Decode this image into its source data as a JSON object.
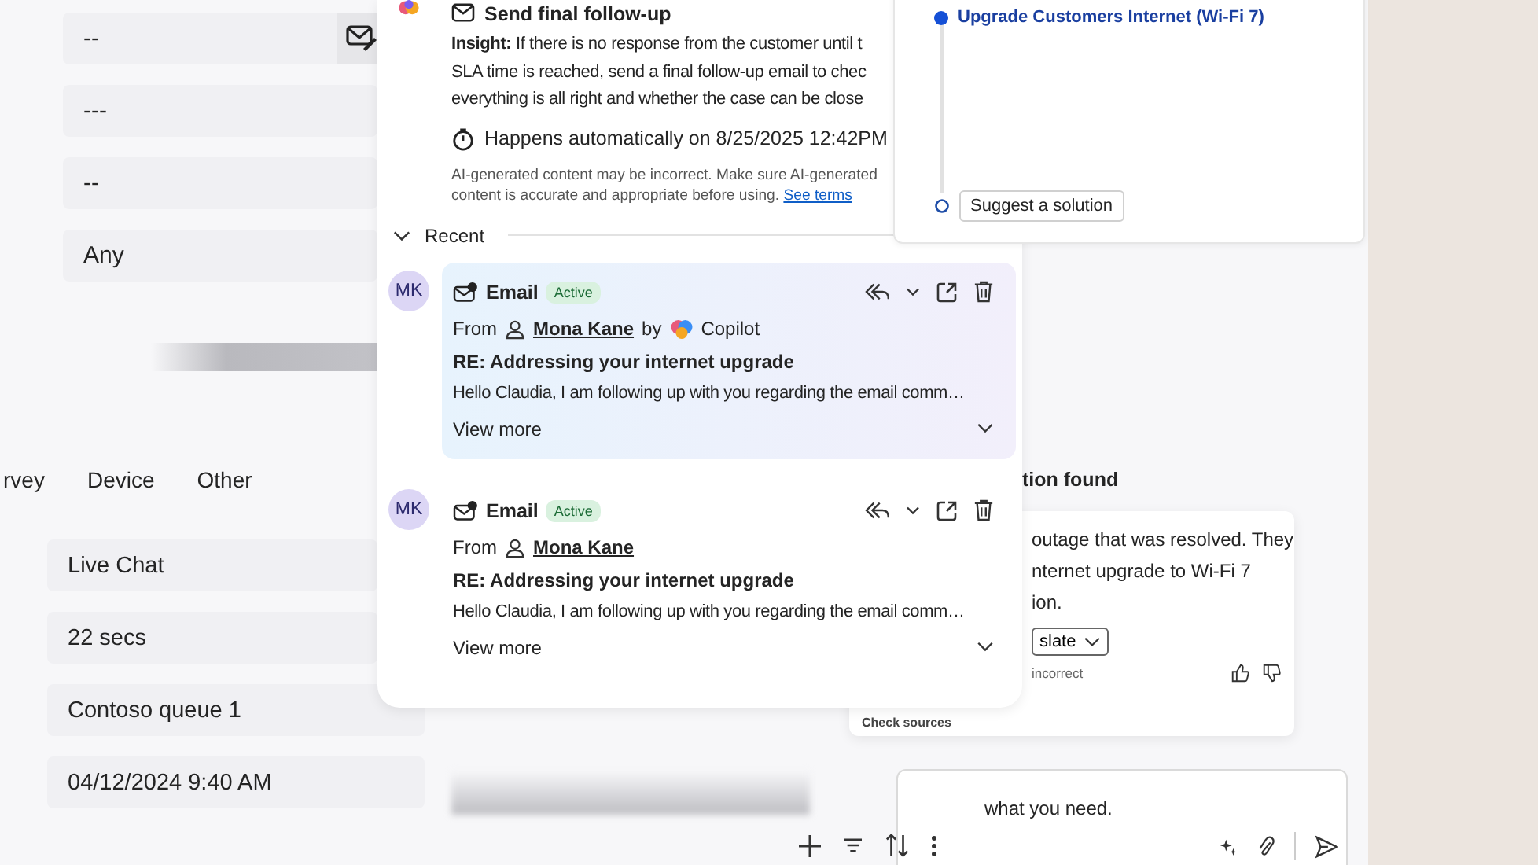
{
  "form_fields": [
    {
      "value": "--",
      "has_icon": true
    },
    {
      "value": "---",
      "has_icon": false
    },
    {
      "value": "--",
      "has_icon": false
    },
    {
      "value": "Any",
      "has_icon": false
    }
  ],
  "tabs": [
    {
      "label": "rvey"
    },
    {
      "label": "Device"
    },
    {
      "label": "Other"
    }
  ],
  "detail_fields": [
    {
      "value": "Live Chat"
    },
    {
      "value": "22 secs"
    },
    {
      "value": "Contoso queue 1"
    },
    {
      "value": "04/12/2024 9:40 AM"
    }
  ],
  "insight_panel": {
    "title": "Send final follow-up",
    "insight_lines": [
      "**Insight:** If there is no response from the customer until t",
      "SLA time is reached, send a final follow-up email to chec",
      "everything is all right and whether the case can be close"
    ],
    "schedule": "Happens automatically on 8/25/2025 12:42PM",
    "disclaimer": "AI-generated content may be incorrect. Make sure AI-generated content is accurate and appropriate before using.",
    "terms_link": "See terms"
  },
  "recent": {
    "label": "Recent",
    "expanded": true,
    "emails": [
      {
        "avatar": "MK",
        "type": "Email",
        "status": "Active",
        "from_label": "From",
        "sender": "Mona Kane",
        "by": "by",
        "agent": "Copilot",
        "subject": "RE: Addressing your internet upgrade",
        "preview": "Hello Claudia, I am following up with you regarding the email comm…",
        "more": "View more",
        "highlighted": true
      },
      {
        "avatar": "MK",
        "type": "Email",
        "status": "Active",
        "from_label": "From",
        "sender": "Mona Kane",
        "subject": "RE: Addressing your internet upgrade",
        "preview": "Hello Claudia, I am following up with you regarding the email comm…",
        "more": "View more",
        "highlighted": false
      }
    ]
  },
  "timeline": {
    "steps": [
      {
        "label": "Upgrade Customers Internet (Wi-Fi 7)",
        "kind": "done"
      }
    ],
    "action": "Suggest a solution"
  },
  "solution": {
    "heading": "tion found",
    "lines": [
      "outage that was resolved. They",
      "nternet upgrade to Wi-Fi 7",
      "ion."
    ],
    "button": "slate",
    "note": "incorrect",
    "sources": "Check sources"
  },
  "chat": {
    "value": "what you need."
  }
}
